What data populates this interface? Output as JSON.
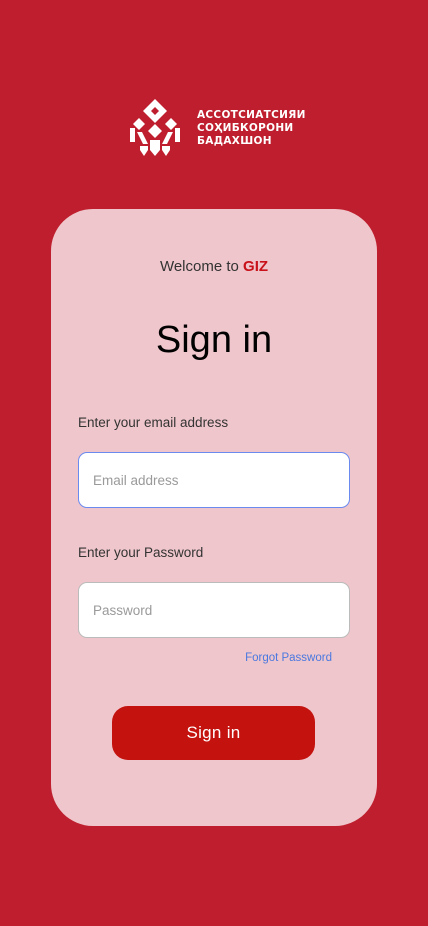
{
  "logo": {
    "line1": "АССОТСИАТСИЯИ",
    "line2": "СОҲИБКОРОНИ",
    "line3": "БАДАХШОН"
  },
  "welcome": {
    "prefix": "Welcome to",
    "brand": "GIZ"
  },
  "title": "Sign in",
  "email": {
    "label": "Enter your email address",
    "placeholder": "Email address",
    "value": ""
  },
  "password": {
    "label": "Enter your Password",
    "placeholder": "Password",
    "value": ""
  },
  "forgot_password": "Forgot Password",
  "signin_button": "Sign in",
  "colors": {
    "background": "#BE1E2D",
    "card": "#EFC6CB",
    "brand_text": "#C8111A",
    "button": "#C4120F",
    "link": "#4A78E0",
    "focus_border": "#6B8AF0"
  }
}
